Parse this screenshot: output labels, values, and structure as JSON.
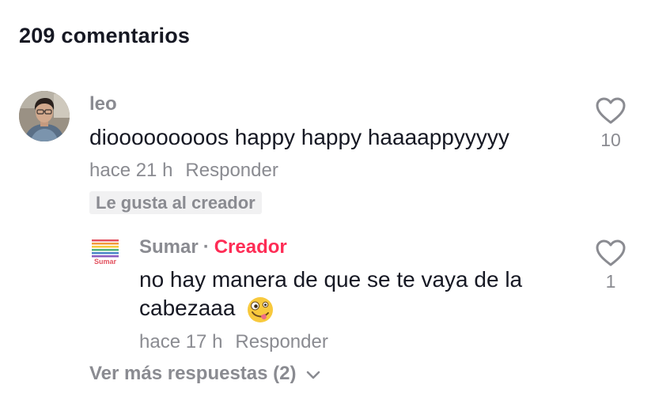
{
  "header": {
    "comment_count_label": "209 comentarios"
  },
  "comment": {
    "username": "leo",
    "text": "diooooooooos happy happy haaaappyyyyy",
    "time": "hace 21 h",
    "reply_label": "Responder",
    "creator_liked_badge": "Le gusta al creador",
    "like_count": "10"
  },
  "reply": {
    "avatar_logo_text": "Sumar",
    "username": "Sumar",
    "separator": "·",
    "creator_label": "Creador",
    "text": "no hay manera de que se te vaya de la cabezaaa",
    "emoji": "zany-face",
    "time": "hace 17 h",
    "reply_label": "Responder",
    "like_count": "1"
  },
  "more_replies": {
    "label": "Ver más respuestas (2)"
  },
  "colors": {
    "creator_accent": "#fe2c55",
    "muted_text": "#8a8b91",
    "primary_text": "#161823",
    "badge_bg": "#f1f1f2"
  }
}
